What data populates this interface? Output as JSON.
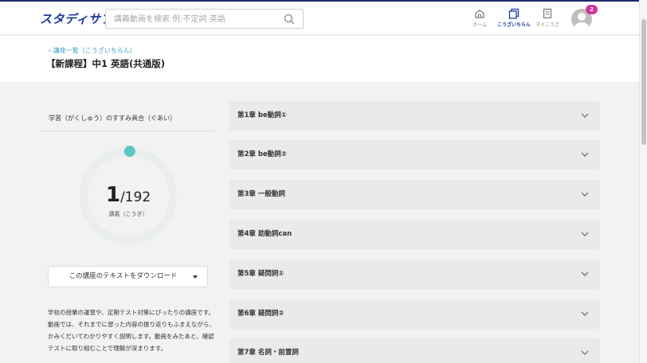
{
  "header": {
    "logo": "スタディサプリ",
    "search_placeholder": "講義動画を検索 例:不定詞 英語",
    "nav": [
      {
        "label": "ホーム",
        "icon": "home-icon"
      },
      {
        "label": "こうざいちらん",
        "icon": "courses-icon"
      },
      {
        "label": "マイこうざ",
        "icon": "my-course-icon"
      }
    ],
    "notification_count": "2"
  },
  "titlebar": {
    "breadcrumb": "‹ 講座一覧（こうざいちらん）",
    "title": "【新課程】中1 英語(共通版)"
  },
  "progress": {
    "label": "学習（がくしゅう）のすすみ具合（ぐあい）",
    "done": "1",
    "total": "/192",
    "fraction": 0.0052,
    "unit": "講義（こうぎ）"
  },
  "download_label": "この講座のテキストをダウンロード",
  "description": "学校の授業の運習や、定期テスト対策にぴったりの講座です。動画では、それまでに習った内容の振り返りもふまえながら、かみくだいてわかりやすく説明します。動画をみたあと、確認テストに取り組むことで理解が深まります。",
  "chapters": [
    {
      "label": "第1章 be動詞①"
    },
    {
      "label": "第2章 be動詞②"
    },
    {
      "label": "第3章 一般動詞"
    },
    {
      "label": "第4章 助動詞can"
    },
    {
      "label": "第5章 疑問詞①"
    },
    {
      "label": "第6章 疑問詞②"
    },
    {
      "label": "第7章 名詞・前置詞"
    }
  ],
  "colors": {
    "brand": "#1b3a9c",
    "progress_accent": "#5cc6c0",
    "ring_track": "#e9edee",
    "badge": "#d6339e"
  }
}
